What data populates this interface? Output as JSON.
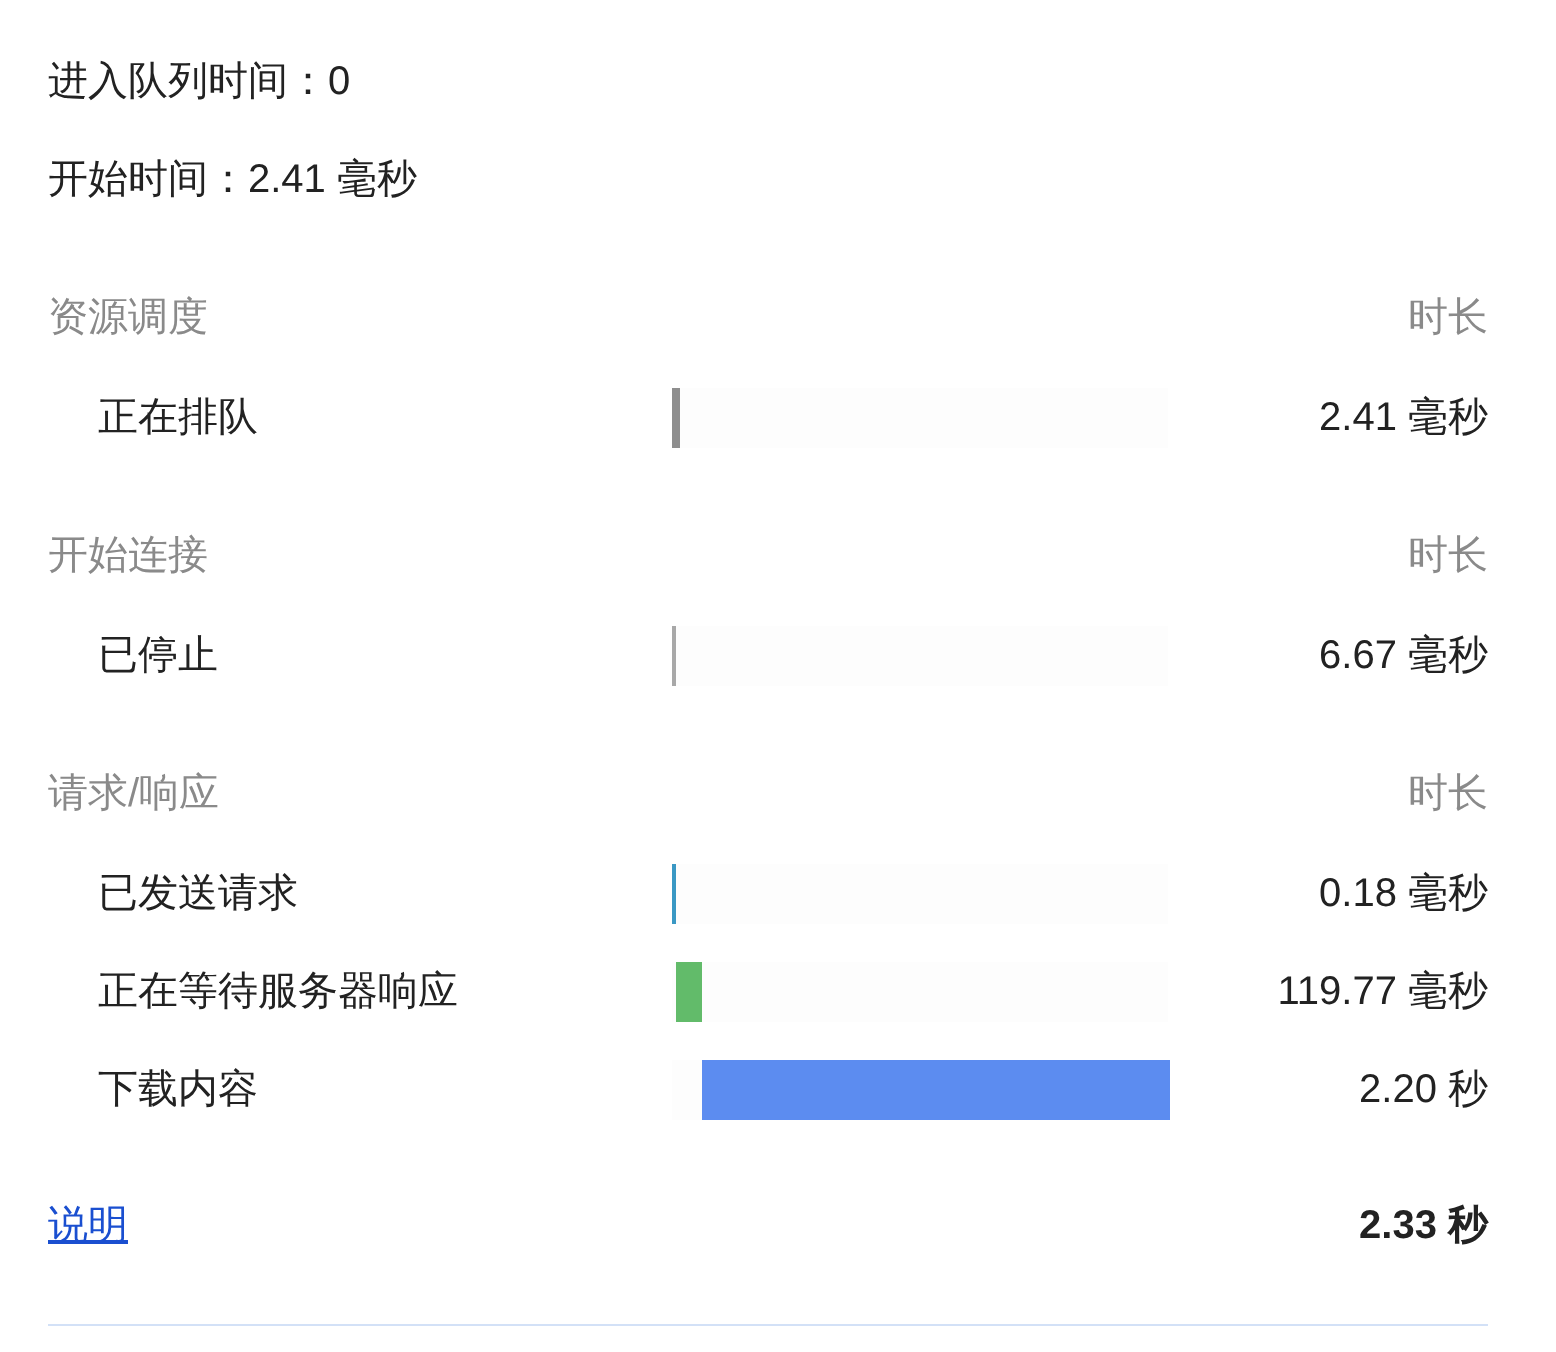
{
  "summary": [
    "进入队列时间：0",
    "开始时间：2.41 毫秒"
  ],
  "sections": [
    {
      "title": "资源调度",
      "column": "时长",
      "rows": [
        {
          "label": "正在排队",
          "level": 0.016,
          "color": "#8e8e8e",
          "duration": "2.41 毫秒"
        }
      ]
    },
    {
      "title": "开始连接",
      "column": "时长",
      "rows": [
        {
          "label": "已停止",
          "level": 0.008,
          "color": "#a8a8a8",
          "duration": "6.67 毫秒"
        }
      ]
    },
    {
      "title": "请求/响应",
      "column": "时长",
      "rows": [
        {
          "label": "已发送请求",
          "level": 0.008,
          "color": "#3a98c4",
          "duration": "0.18 毫秒"
        },
        {
          "label": "正在等待服务器响应",
          "level": 0.052,
          "color": "#62bb6a",
          "duration": "119.77 毫秒"
        },
        {
          "label": "下载内容",
          "level": 0.944,
          "color": "#5c8cf0",
          "duration": "2.20 秒"
        }
      ]
    }
  ],
  "footer": {
    "link": "说明",
    "total": "2.33 秒"
  }
}
